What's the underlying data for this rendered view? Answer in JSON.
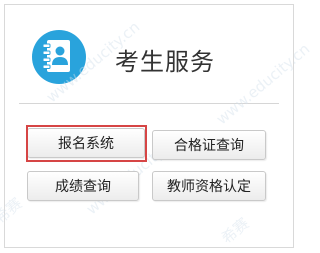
{
  "panel": {
    "title": "考生服务",
    "icon": "contact-book-icon"
  },
  "buttons": {
    "registration": "报名系统",
    "certificate_query": "合格证查询",
    "score_query": "成绩查询",
    "teacher_cert": "教师资格认定"
  },
  "watermark": {
    "text": "www.educity.cn",
    "brand": "希赛"
  },
  "colors": {
    "icon_blue": "#29a3dc",
    "highlight_red": "#d64545"
  }
}
